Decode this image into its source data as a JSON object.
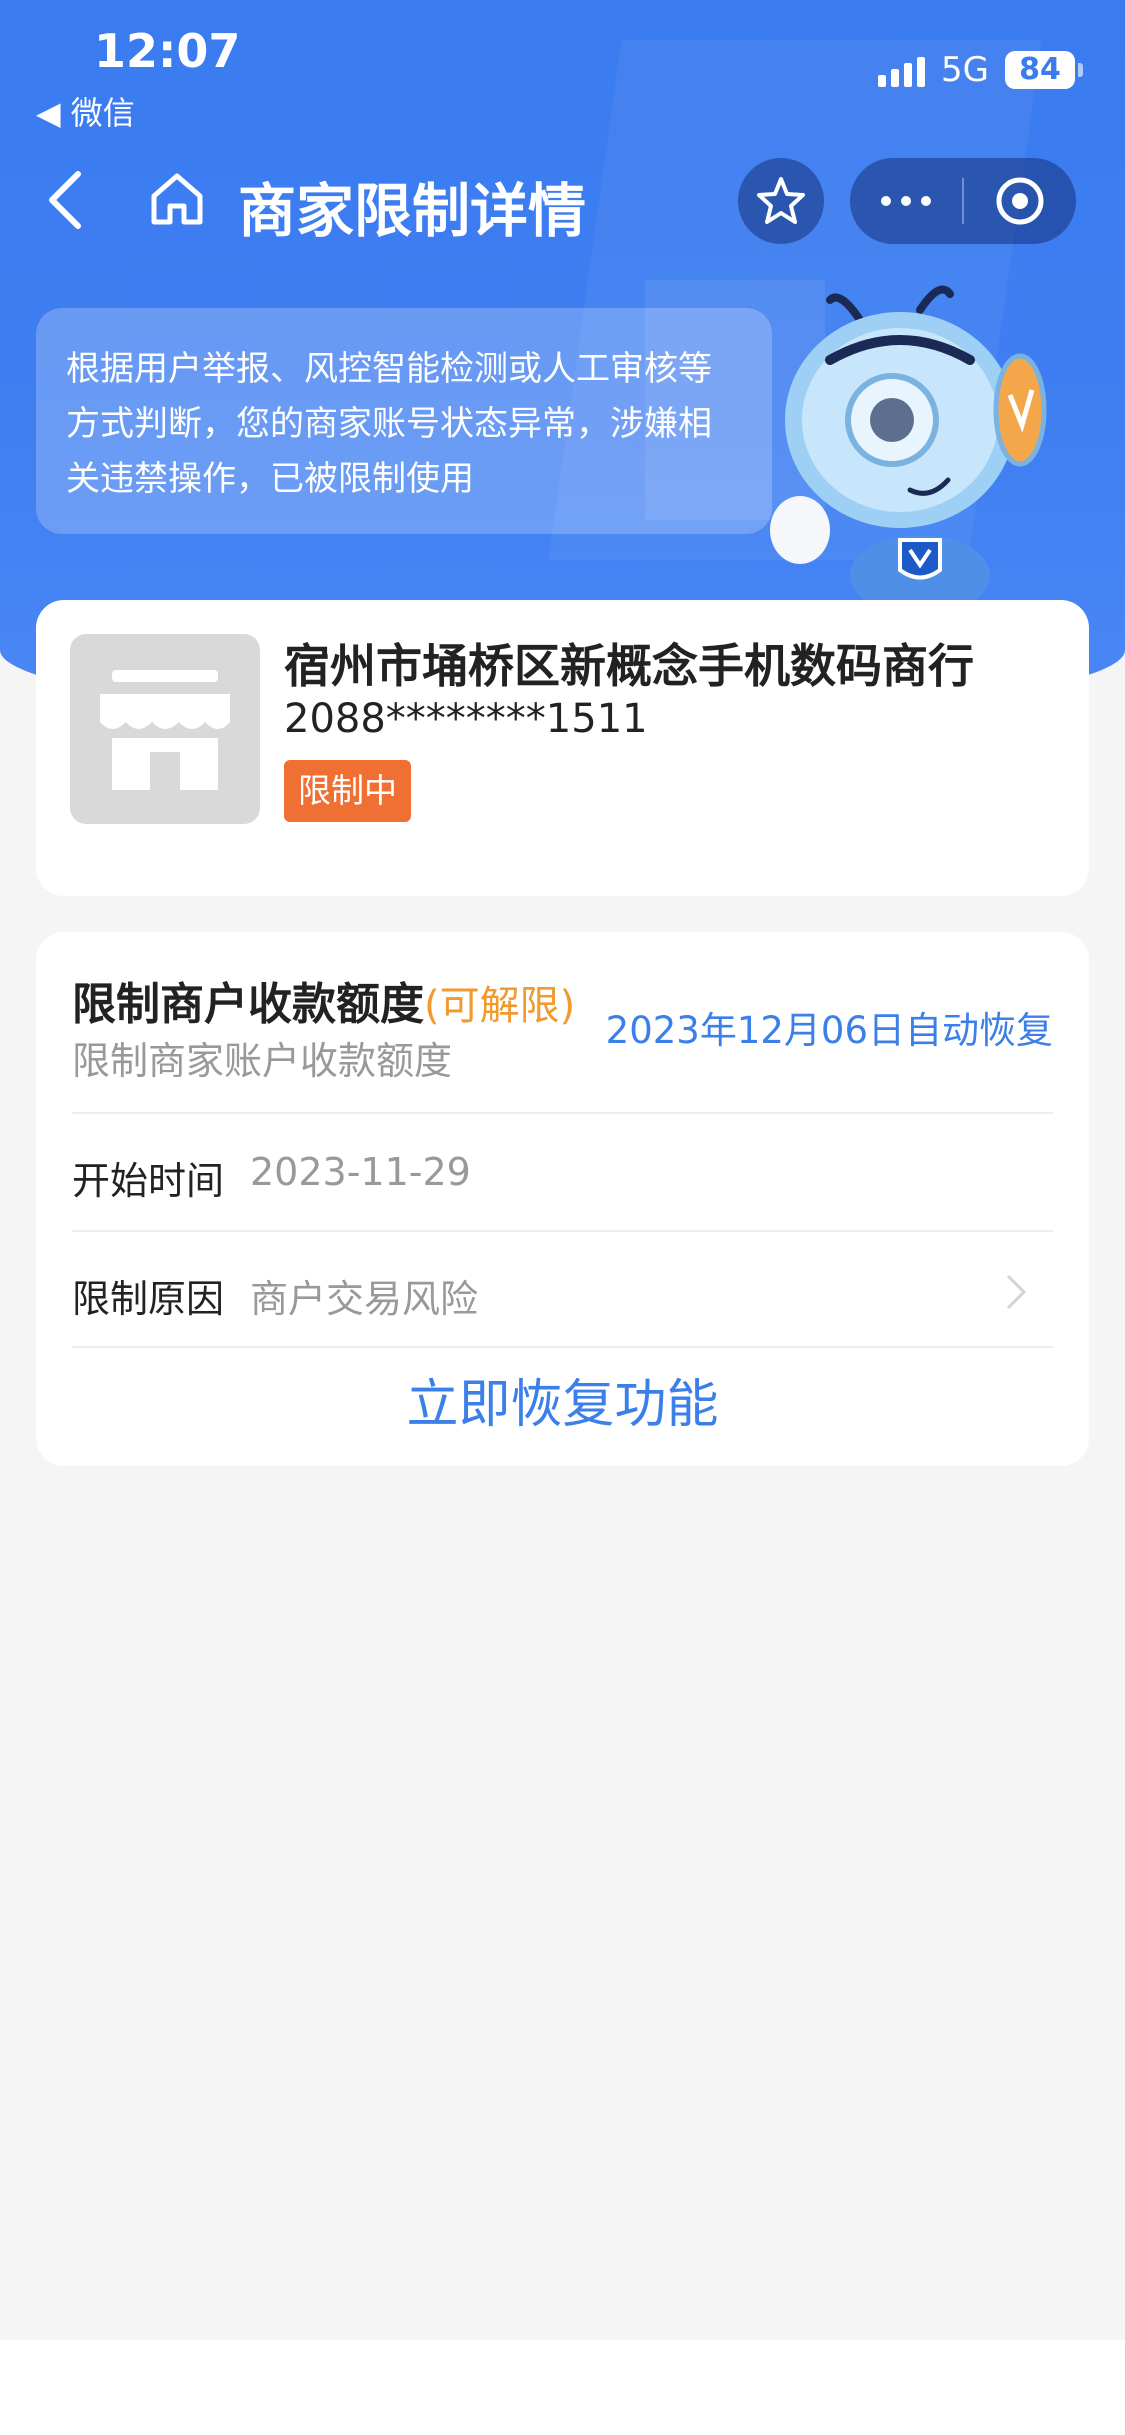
{
  "status_bar": {
    "time": "12:07",
    "back_app": "◀ 微信",
    "network": "5G",
    "battery": "84"
  },
  "nav": {
    "title": "商家限制详情",
    "icons": [
      "back-icon",
      "home-icon",
      "star-icon",
      "more-icon",
      "target-icon"
    ]
  },
  "notice": {
    "text": "根据用户举报、风控智能检测或人工审核等方式判断，您的商家账号状态异常，涉嫌相关违禁操作，已被限制使用"
  },
  "merchant": {
    "name": "宿州市埇桥区新概念手机数码商行",
    "account_id": "2088********1511",
    "status_badge": "限制中"
  },
  "restriction": {
    "title": "限制商户收款额度",
    "tag": "(可解限)",
    "subtitle": "限制商家账户收款额度",
    "auto_recover": "2023年12月06日自动恢复",
    "start_label": "开始时间",
    "start_value": "2023-11-29",
    "reason_label": "限制原因",
    "reason_value": "商户交易风险",
    "restore_button": "立即恢复功能"
  },
  "colors": {
    "header_blue": "#3a7bf0",
    "badge_orange": "#f07034",
    "link_blue": "#3b7fe8",
    "tag_orange": "#f29a2e"
  }
}
